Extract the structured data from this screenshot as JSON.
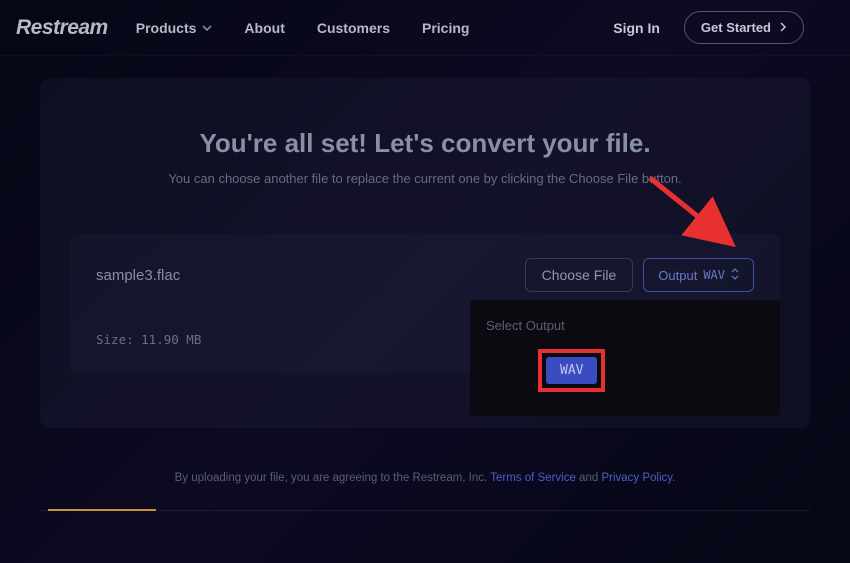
{
  "header": {
    "logo": "Restream",
    "nav": {
      "products": "Products",
      "about": "About",
      "customers": "Customers",
      "pricing": "Pricing"
    },
    "sign_in": "Sign In",
    "get_started": "Get Started"
  },
  "main": {
    "headline": "You're all set! Let's convert your file.",
    "subtext": "You can choose another file to replace the current one by clicking the Choose File button."
  },
  "file": {
    "name": "sample3.flac",
    "size_label": "Size: 11.90 MB",
    "choose_button": "Choose File",
    "output_label": "Output",
    "output_format": "WAV"
  },
  "dropdown": {
    "title": "Select Output",
    "options": {
      "wav": "WAV"
    }
  },
  "footer": {
    "prefix": "By uploading your file, you are agreeing to the Restream, Inc. ",
    "tos": "Terms of Service",
    "and": " and ",
    "privacy": "Privacy Policy",
    "suffix": "."
  }
}
